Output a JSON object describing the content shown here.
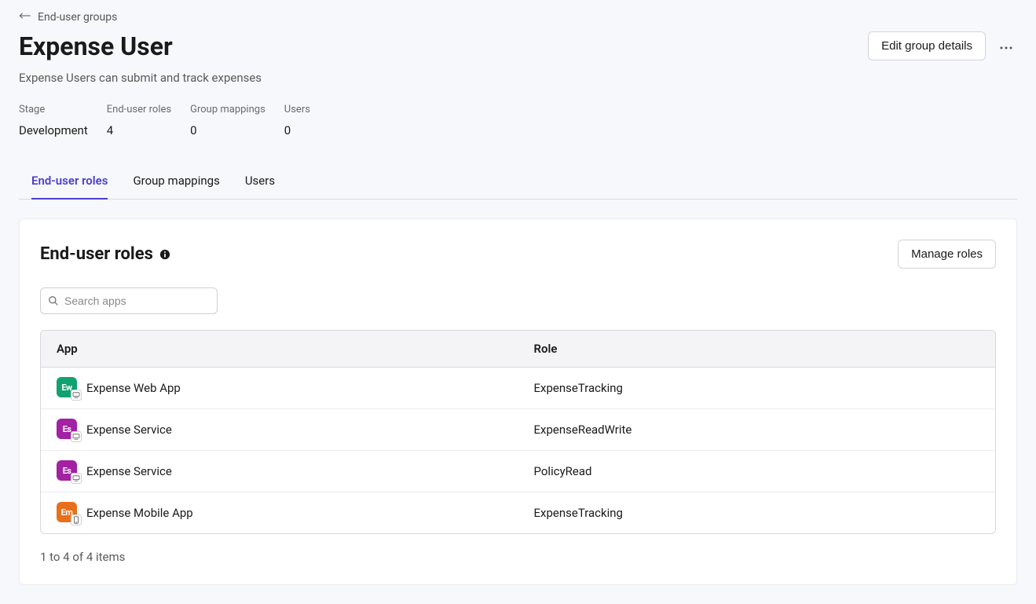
{
  "breadcrumb": {
    "label": "End-user groups"
  },
  "header": {
    "title": "Expense User",
    "subtitle": "Expense Users can submit and track expenses",
    "edit_button": "Edit group details"
  },
  "stats": [
    {
      "label": "Stage",
      "value": "Development"
    },
    {
      "label": "End-user roles",
      "value": "4"
    },
    {
      "label": "Group mappings",
      "value": "0"
    },
    {
      "label": "Users",
      "value": "0"
    }
  ],
  "tabs": [
    {
      "label": "End-user roles",
      "active": true
    },
    {
      "label": "Group mappings",
      "active": false
    },
    {
      "label": "Users",
      "active": false
    }
  ],
  "panel": {
    "title": "End-user roles",
    "manage_button": "Manage roles",
    "search_placeholder": "Search apps",
    "columns": {
      "app": "App",
      "role": "Role"
    },
    "rows": [
      {
        "app": "Expense Web App",
        "role": "ExpenseTracking",
        "icon_text": "Ew",
        "icon_color": "app-green",
        "sub": "desktop"
      },
      {
        "app": "Expense Service",
        "role": "ExpenseReadWrite",
        "icon_text": "Es",
        "icon_color": "app-purple",
        "sub": "desktop"
      },
      {
        "app": "Expense Service",
        "role": "PolicyRead",
        "icon_text": "Es",
        "icon_color": "app-purple",
        "sub": "desktop"
      },
      {
        "app": "Expense Mobile App",
        "role": "ExpenseTracking",
        "icon_text": "Em",
        "icon_color": "app-orange",
        "sub": "mobile"
      }
    ],
    "footer": "1 to 4 of 4 items"
  }
}
